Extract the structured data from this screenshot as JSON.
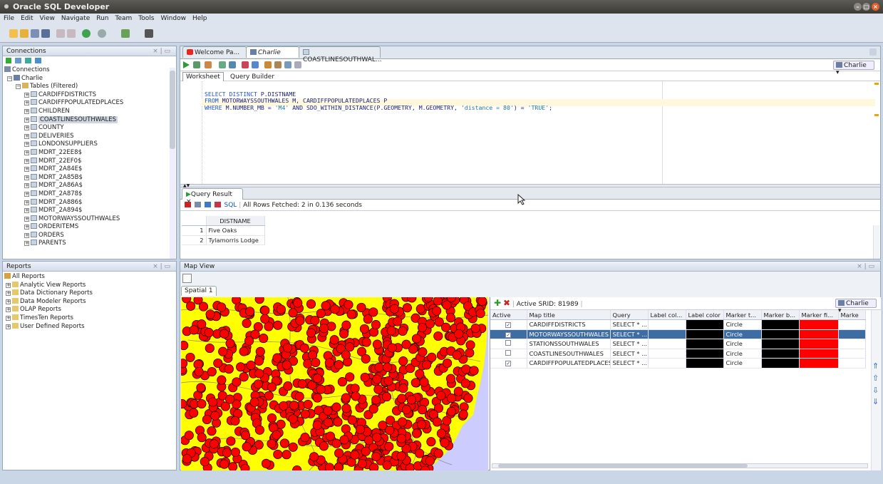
{
  "app": {
    "title": "Oracle SQL Developer"
  },
  "menu": [
    "File",
    "Edit",
    "View",
    "Navigate",
    "Run",
    "Team",
    "Tools",
    "Window",
    "Help"
  ],
  "connections_panel": {
    "title": "Connections",
    "root": "Connections",
    "connection": "Charlie",
    "tables_node": "Tables (Filtered)",
    "tables": [
      "CARDIFFDISTRICTS",
      "CARDIFFPOPULATEDPLACES",
      "CHILDREN",
      "COASTLINESOUTHWALES",
      "COUNTY",
      "DELIVERIES",
      "LONDONSUPPLIERS",
      "MDRT_22EE8$",
      "MDRT_22EF0$",
      "MDRT_2A84E$",
      "MDRT_2A85B$",
      "MDRT_2A86A$",
      "MDRT_2A878$",
      "MDRT_2A886$",
      "MDRT_2A894$",
      "MOTORWAYSSOUTHWALES",
      "ORDERITEMS",
      "ORDERS",
      "PARENTS"
    ],
    "selected": "COASTLINESOUTHWALES"
  },
  "reports_panel": {
    "title": "Reports",
    "items": [
      "All Reports",
      "Analytic View Reports",
      "Data Dictionary Reports",
      "Data Modeler Reports",
      "OLAP Reports",
      "TimesTen Reports",
      "User Defined Reports"
    ]
  },
  "editor_tabs": [
    "Welcome Pa...",
    "Charlie",
    "COASTLINESOUTHWAL..."
  ],
  "connection_selector": "Charlie",
  "worksheet_tabs": [
    "Worksheet",
    "Query Builder"
  ],
  "sql": {
    "line1_kw": "SELECT DISTINCT",
    "line1_rest": " P.DISTNAME",
    "line2_kw": "FROM",
    "line2_rest": " MOTORWAYSSOUTHWALES M, CARDIFFPOPULATEDPLACES P",
    "line3_kw": "WHERE",
    "line3_a": " M.NUMBER_MB = ",
    "line3_s1": "'M4'",
    "line3_b": " AND SDO_WITHIN_DISTANCE(P.GEOMETRY, M.GEOMETRY, ",
    "line3_s2": "'distance = 80'",
    "line3_c": ") = ",
    "line3_s3": "'TRUE'",
    "line3_d": ";"
  },
  "query_result": {
    "tab": "Query Result",
    "sql_link": "SQL",
    "status": "All Rows Fetched: 2 in 0.136 seconds",
    "column": "DISTNAME",
    "rows": [
      {
        "n": "1",
        "v": "Five Oaks"
      },
      {
        "n": "2",
        "v": "Tylamorris Lodge"
      }
    ]
  },
  "map_view": {
    "title": "Map View",
    "tab": "Spatial 1",
    "active_srid": "Active SRID: 81989",
    "connection": "Charlie",
    "columns": [
      "Active",
      "Map title",
      "Query",
      "Label col...",
      "Label color",
      "Marker t...",
      "Marker b...",
      "Marker fi...",
      "Marke"
    ],
    "layers": [
      {
        "active": true,
        "title": "CARDIFFDISTRICTS",
        "query": "SELECT * ...",
        "marker": "Circle",
        "selected": false
      },
      {
        "active": true,
        "title": "MOTORWAYSSOUTHWALES",
        "query": "SELECT * ...",
        "marker": "Circle",
        "selected": true
      },
      {
        "active": false,
        "title": "STATIONSSOUTHWALES",
        "query": "SELECT * ...",
        "marker": "Circle",
        "selected": false
      },
      {
        "active": false,
        "title": "COASTLINESOUTHWALES",
        "query": "SELECT * ...",
        "marker": "Circle",
        "selected": false
      },
      {
        "active": true,
        "title": "CARDIFFPOPULATEDPLACES",
        "query": "SELECT * ...",
        "marker": "Circle",
        "selected": false
      }
    ],
    "label_color": "#000000",
    "marker_border": "#000000",
    "marker_fill": "#ff0000",
    "land_color": "#ffff00",
    "sea_color": "#ccccff"
  }
}
